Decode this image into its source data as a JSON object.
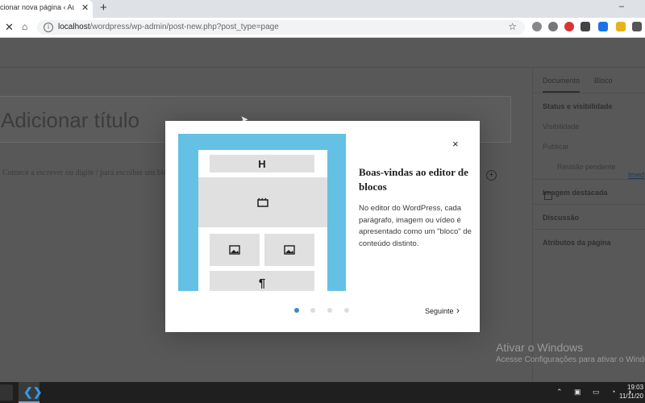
{
  "browser": {
    "tab_title": "cionar nova página ‹ Aula W",
    "tab_close": "✕",
    "new_tab": "+",
    "window_controls": "–",
    "url_host": "localhost",
    "url_path": "/wordpress/wp-admin/post-new.php?post_type=page",
    "star": "☆"
  },
  "editor": {
    "title_placeholder": "Adicionar título",
    "paragraph_placeholder": "Comece a escrever ou digite / para escolher um bloco",
    "add_block": "+"
  },
  "sidebar": {
    "tabs": [
      {
        "label": "Documento"
      },
      {
        "label": "Bloco"
      }
    ],
    "status_heading": "Status e visibilidade",
    "visibility_label": "Visibilidade",
    "publish_label": "Publicar",
    "publish_link": "Imed",
    "pending_review": "Revisão pendente",
    "featured_image": "Imagem destacada",
    "discussion": "Discussão",
    "page_attributes": "Atributos da página"
  },
  "modal": {
    "close_icon": "×",
    "title": "Boas-vindas ao editor de blocos",
    "body": "No editor do WordPress, cada parágrafo, imagem ou vídeo é apresentado como um \"bloco\" de conteúdo distinto.",
    "illustration": {
      "heading_glyph": "H",
      "paragraph_glyph": "¶"
    },
    "pager": {
      "total": 4,
      "current": 1
    },
    "next_label": "Seguinte",
    "next_icon": "chevron-right-icon"
  },
  "watermark": {
    "title": "Ativar o Windows",
    "subtitle": "Acesse Configurações para ativar o Windows"
  },
  "taskbar": {
    "time": "19:03",
    "date": "11/11/20",
    "tray_icons": "⌃ ▣ ▭ ◔ ◑"
  },
  "colors": {
    "illustration_bg": "#64c1e4",
    "active_dot": "#3a87c7",
    "overlay": "#585858"
  }
}
